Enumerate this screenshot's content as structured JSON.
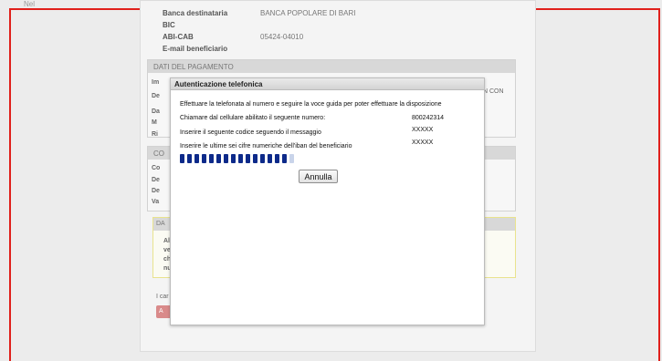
{
  "top_label": "Nel",
  "beneficiario": [
    {
      "label": "Banca destinataria",
      "value": "BANCA POPOLARE DI BARI"
    },
    {
      "label": "BIC",
      "value": ""
    },
    {
      "label": "ABI-CAB",
      "value": "05424-04010"
    },
    {
      "label": "E-mail beneficiario",
      "value": ""
    }
  ],
  "sections": {
    "pagamento": "DATI DEL PAGAMENTO",
    "pagamento_stubs": [
      "Im",
      "De",
      "Da",
      "M",
      "Ri"
    ],
    "pagamento_right": "IN CON",
    "conto": "CO",
    "conto_stubs": [
      "Co",
      "De",
      "De",
      "Va"
    ],
    "yellow_hdr": "DA",
    "yellow_stubs": [
      "Al",
      "ve",
      "ch",
      "nu"
    ]
  },
  "note": "I car",
  "action_button": "A",
  "modal": {
    "title": "Autenticazione telefonica",
    "intro": "Effettuare la telefonata al numero e seguire la voce guida per poter effettuare la disposizione",
    "rows": [
      {
        "label": "Chiamare dal cellulare abilitato il seguente numero:",
        "value": "800242314"
      },
      {
        "label": "Inserire il seguente codice seguendo il messaggio",
        "value": "XXXXX"
      },
      {
        "label": "Inserire le ultime sei cifre numeriche dell'iban del beneficiario",
        "value": "XXXXX"
      }
    ],
    "progress_fraction": 0.93,
    "cancel_label": "Annulla"
  }
}
